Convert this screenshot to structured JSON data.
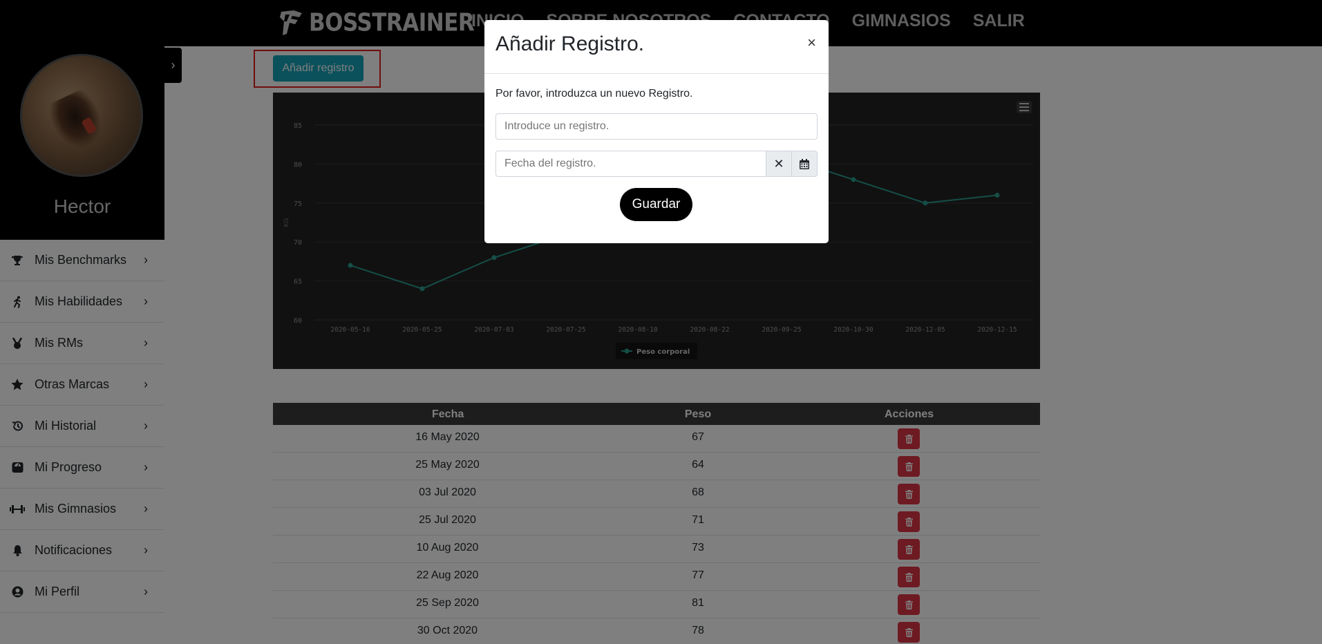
{
  "brand": {
    "name": "BOSSTRAINER"
  },
  "nav": {
    "items": [
      "INICIO",
      "SOBRE NOSOTROS",
      "CONTACTO",
      "GIMNASIOS",
      "SALIR"
    ]
  },
  "profile": {
    "username": "Hector"
  },
  "sidebar": {
    "items": [
      {
        "label": "Mis Benchmarks",
        "icon": "trophy-icon"
      },
      {
        "label": "Mis Habilidades",
        "icon": "running-icon"
      },
      {
        "label": "Mis RMs",
        "icon": "medal-icon"
      },
      {
        "label": "Otras Marcas",
        "icon": "star-icon"
      },
      {
        "label": "Mi Historial",
        "icon": "history-icon"
      },
      {
        "label": "Mi Progreso",
        "icon": "scale-icon"
      },
      {
        "label": "Mis Gimnasios",
        "icon": "dumbbell-icon"
      },
      {
        "label": "Notificaciones",
        "icon": "bell-icon"
      },
      {
        "label": "Mi Perfil",
        "icon": "user-circle-icon"
      }
    ]
  },
  "main": {
    "add_button": "Añadir registro"
  },
  "chart_data": {
    "type": "line",
    "categories": [
      "2020-05-16",
      "2020-05-25",
      "2020-07-03",
      "2020-07-25",
      "2020-08-10",
      "2020-08-22",
      "2020-09-25",
      "2020-10-30",
      "2020-12-05",
      "2020-12-15"
    ],
    "series": [
      {
        "name": "Peso corporal",
        "values": [
          67,
          64,
          68,
          71,
          73,
          77,
          81,
          78,
          75,
          76
        ],
        "color": "#2a9d8f"
      }
    ],
    "ylabel": "KG",
    "ylim": [
      60,
      85
    ],
    "yticks": [
      60,
      65,
      70,
      75,
      80,
      85
    ],
    "grid": true,
    "legend": "bottom"
  },
  "table": {
    "headers": [
      "Fecha",
      "Peso",
      "Acciones"
    ],
    "rows": [
      {
        "fecha": "16 May 2020",
        "peso": "67"
      },
      {
        "fecha": "25 May 2020",
        "peso": "64"
      },
      {
        "fecha": "03 Jul 2020",
        "peso": "68"
      },
      {
        "fecha": "25 Jul 2020",
        "peso": "71"
      },
      {
        "fecha": "10 Aug 2020",
        "peso": "73"
      },
      {
        "fecha": "22 Aug 2020",
        "peso": "77"
      },
      {
        "fecha": "25 Sep 2020",
        "peso": "81"
      },
      {
        "fecha": "30 Oct 2020",
        "peso": "78"
      }
    ]
  },
  "modal": {
    "title": "Añadir Registro.",
    "close": "×",
    "text": "Por favor, introduzca un nuevo Registro.",
    "registro_placeholder": "Introduce un registro.",
    "fecha_placeholder": "Fecha del registro.",
    "clear_icon": "✕",
    "save": "Guardar"
  }
}
